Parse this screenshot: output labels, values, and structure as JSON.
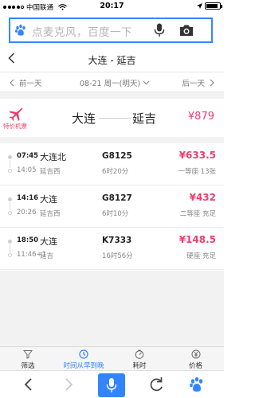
{
  "status_bar": {
    "carrier": "中国联通",
    "network": "",
    "time": "20:17",
    "battery_level": 0.9
  },
  "search": {
    "placeholder": "点麦克风，百度一下",
    "icons": [
      "baidu-paw-icon",
      "microphone-icon",
      "camera-icon"
    ]
  },
  "nav": {
    "title": "大连 - 延吉",
    "back_icon": "chevron-left-icon"
  },
  "date_bar": {
    "prev_label": "前一天",
    "current_label": "08-21 周一(明天)",
    "next_label": "后一天"
  },
  "flight_promo": {
    "tag": "特价机票",
    "from": "大连",
    "to": "延吉",
    "price": "¥879",
    "icon": "airplane-icon"
  },
  "trains": [
    {
      "depart_time": "07:45",
      "depart_station": "大连北",
      "arrive_time": "14:05",
      "arrive_station": "延吉西",
      "train_no": "G8125",
      "duration": "6时20分",
      "price": "¥633.5",
      "seat": "一等座 13张"
    },
    {
      "depart_time": "14:16",
      "depart_station": "大连",
      "arrive_time": "20:26",
      "arrive_station": "延吉西",
      "train_no": "G8127",
      "duration": "6时10分",
      "price": "¥432",
      "seat": "二等座 充足"
    },
    {
      "depart_time": "18:50",
      "depart_station": "大连",
      "arrive_time": "11:46+1",
      "arrive_station": "延吉",
      "train_no": "K7333",
      "duration": "16时56分",
      "price": "¥148.5",
      "seat": "硬座 充足"
    }
  ],
  "tabs": [
    {
      "label": "筛选",
      "icon": "filter-icon"
    },
    {
      "label": "时间从早到晚",
      "icon": "clock-icon",
      "active": true
    },
    {
      "label": "耗时",
      "icon": "timer-icon"
    },
    {
      "label": "价格",
      "icon": "yen-icon"
    }
  ],
  "colors": {
    "accent": "#3385ff",
    "price": "#e8416e"
  }
}
